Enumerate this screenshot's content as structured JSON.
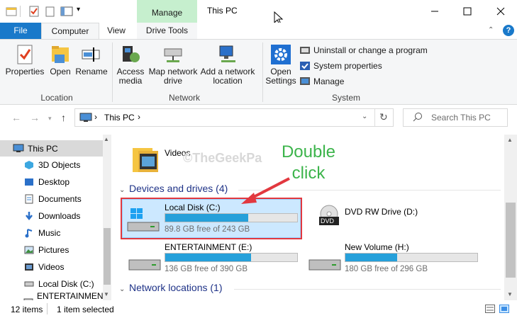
{
  "titlebar": {
    "context_tab": "Manage",
    "title": "This PC"
  },
  "tabs": {
    "file": "File",
    "computer": "Computer",
    "view": "View",
    "drive_tools": "Drive Tools"
  },
  "ribbon": {
    "properties": "Properties",
    "open": "Open",
    "rename": "Rename",
    "access_media": "Access media",
    "map_network_drive": "Map network drive",
    "add_network_location": "Add a network location",
    "open_settings": "Open Settings",
    "uninstall": "Uninstall or change a program",
    "system_properties": "System properties",
    "manage": "Manage",
    "group_location": "Location",
    "group_network": "Network",
    "group_system": "System"
  },
  "address": {
    "path": "This PC",
    "search_placeholder": "Search This PC"
  },
  "nav": {
    "items": [
      {
        "label": "This PC",
        "icon": "computer-icon"
      },
      {
        "label": "3D Objects",
        "icon": "cube-icon"
      },
      {
        "label": "Desktop",
        "icon": "desktop-icon"
      },
      {
        "label": "Documents",
        "icon": "document-icon"
      },
      {
        "label": "Downloads",
        "icon": "download-icon"
      },
      {
        "label": "Music",
        "icon": "music-icon"
      },
      {
        "label": "Pictures",
        "icon": "picture-icon"
      },
      {
        "label": "Videos",
        "icon": "video-icon"
      },
      {
        "label": "Local Disk (C:)",
        "icon": "drive-icon"
      },
      {
        "label": "ENTERTAINMENT (E:)",
        "icon": "drive-icon"
      }
    ]
  },
  "content": {
    "videos_label": "Videos",
    "devices_header": "Devices and drives (4)",
    "network_header": "Network locations (1)",
    "drives": [
      {
        "name": "Local Disk (C:)",
        "free": "89.8 GB free of 243 GB",
        "used_fraction": 0.63
      },
      {
        "name": "DVD RW Drive (D:)",
        "free": "",
        "used_fraction": null
      },
      {
        "name": "ENTERTAINMENT (E:)",
        "free": "136 GB free of 390 GB",
        "used_fraction": 0.65
      },
      {
        "name": "New Volume (H:)",
        "free": "180 GB free of 296 GB",
        "used_fraction": 0.39
      }
    ],
    "dvd_badge": "DVD"
  },
  "status": {
    "items": "12 items",
    "selected": "1 item selected"
  },
  "annotation": {
    "line1": "Double",
    "line2": "click",
    "watermark": "©TheGeekPa"
  },
  "colors": {
    "accent": "#1979ca",
    "bar_fill": "#26a0da",
    "highlight": "#e2383f",
    "callout": "#3cb44b",
    "context_tab": "#c6efce"
  }
}
